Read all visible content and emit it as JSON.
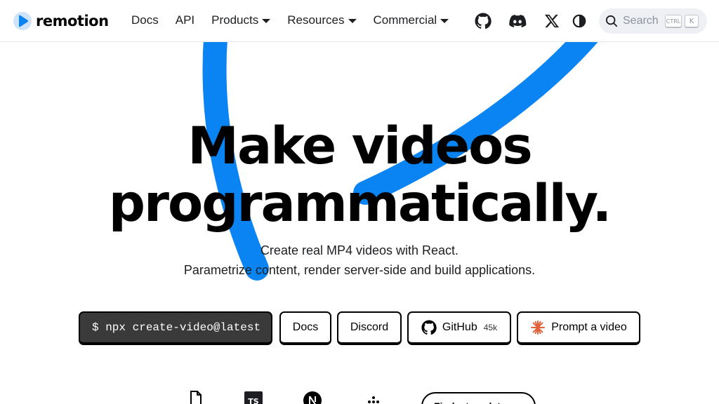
{
  "brand": {
    "name": "remotion",
    "accent_color": "#0b84f3"
  },
  "nav": {
    "links": [
      {
        "label": "Docs"
      },
      {
        "label": "API"
      },
      {
        "label": "Products"
      },
      {
        "label": "Resources"
      },
      {
        "label": "Commercial"
      }
    ],
    "icons": [
      "github-icon",
      "discord-icon",
      "x-icon",
      "theme-toggle-icon"
    ],
    "search": {
      "placeholder": "Search",
      "shortcut_modifier": "CTRL",
      "shortcut_key": "K"
    }
  },
  "hero": {
    "title_line1": "Make videos",
    "title_line2": "programmatically.",
    "subtitle_line1": "Create real MP4 videos with React.",
    "subtitle_line2": "Parametrize content, render server-side and build applications."
  },
  "cta": {
    "command": "$ npx create-video@latest",
    "docs": "Docs",
    "discord": "Discord",
    "github": "GitHub",
    "github_stars": "45k",
    "prompt": "Prompt a video"
  },
  "bottom": {
    "icons": [
      "file-icon",
      "typescript-icon",
      "nextjs-icon",
      "dots-icon"
    ],
    "templates_label": "Find a template"
  }
}
